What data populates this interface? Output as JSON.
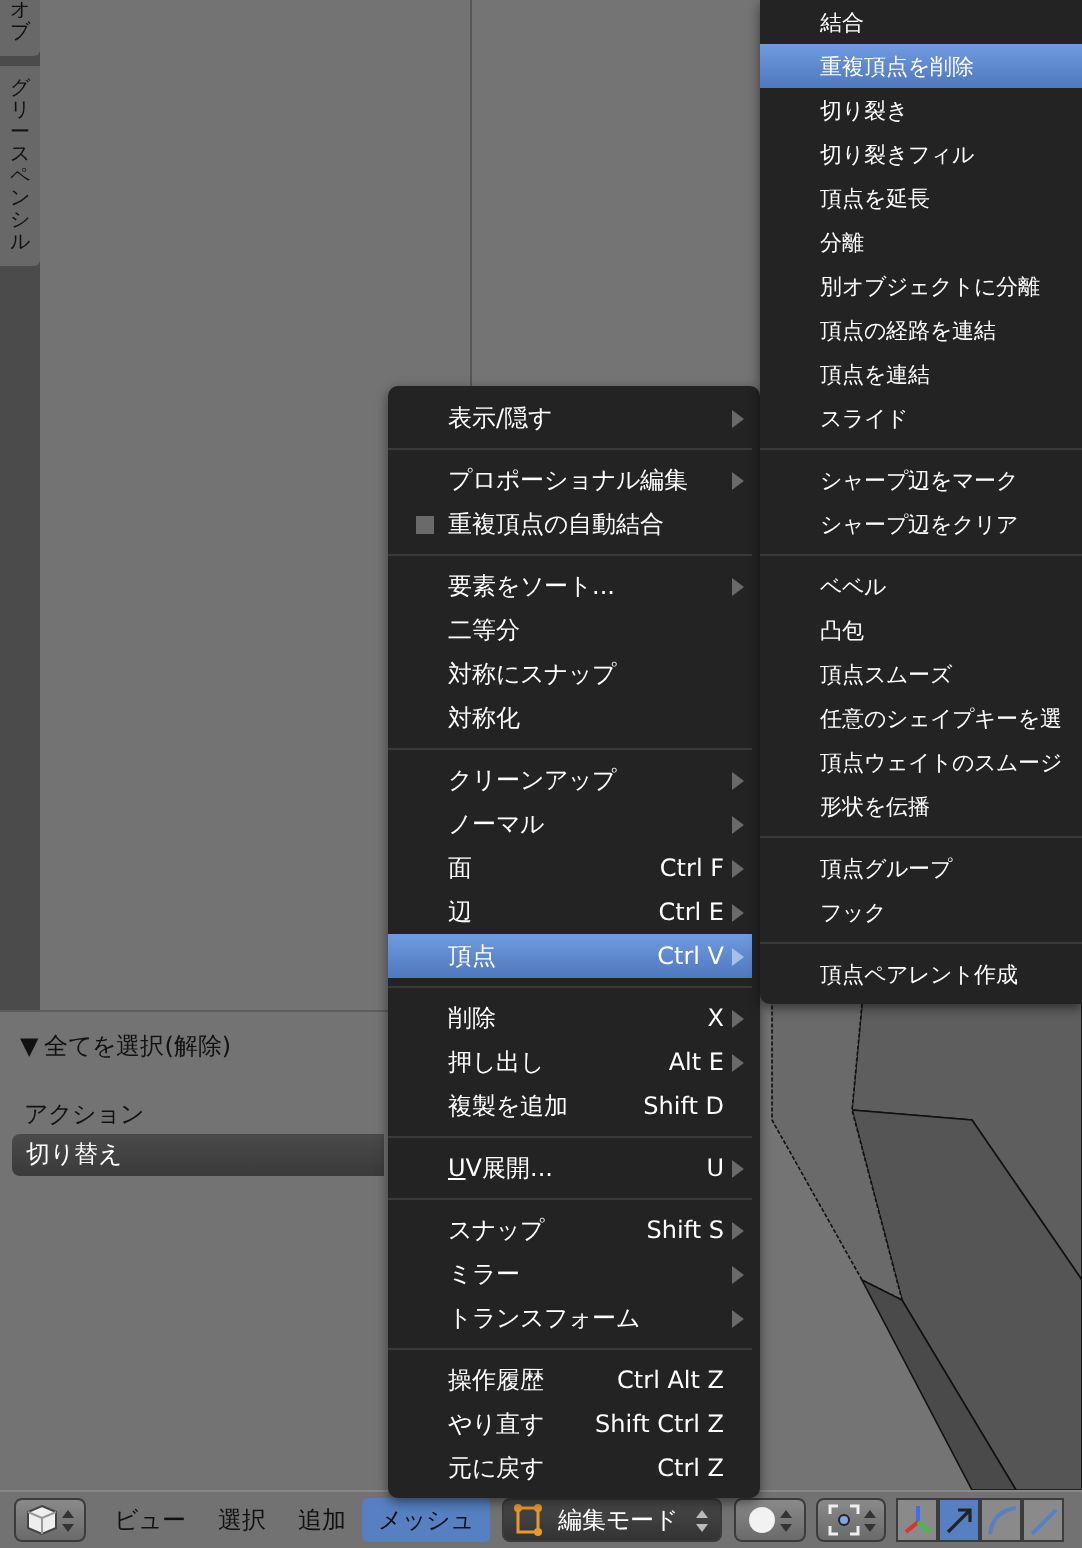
{
  "tool_shelf": {
    "tabs": [
      {
        "label": "オブ",
        "selected": false
      },
      {
        "label": "グリースペンシル",
        "selected": false
      }
    ]
  },
  "operator_panel": {
    "toggle_icon": "▼",
    "title": "全てを選択(解除)",
    "action_label": "アクション",
    "action_value": "切り替え"
  },
  "menu": {
    "groups": [
      [
        {
          "label": "表示/隠す",
          "submenu": true,
          "selected": false
        }
      ],
      [
        {
          "label": "プロポーショナル編集",
          "submenu": true,
          "selected": false
        },
        {
          "label": "重複頂点の自動結合",
          "kind": "checkbox",
          "checked": false,
          "submenu": false,
          "selected": false
        }
      ],
      [
        {
          "label": "要素をソート...",
          "submenu": true,
          "selected": false
        },
        {
          "label": "二等分",
          "submenu": false,
          "selected": false
        },
        {
          "label": "対称にスナップ",
          "submenu": false,
          "selected": false
        },
        {
          "label": "対称化",
          "submenu": false,
          "selected": false
        }
      ],
      [
        {
          "label": "クリーンアップ",
          "submenu": true,
          "selected": false
        },
        {
          "label": "ノーマル",
          "submenu": true,
          "selected": false
        },
        {
          "label": "面",
          "shortcut": "Ctrl F",
          "submenu": true,
          "selected": false
        },
        {
          "label": "辺",
          "shortcut": "Ctrl E",
          "submenu": true,
          "selected": false
        },
        {
          "label": "頂点",
          "shortcut": "Ctrl V",
          "submenu": true,
          "selected": true
        }
      ],
      [
        {
          "label": "削除",
          "shortcut": "X",
          "submenu": true,
          "selected": false
        },
        {
          "label": "押し出し",
          "shortcut": "Alt E",
          "submenu": true,
          "selected": false
        },
        {
          "label": "複製を追加",
          "shortcut": "Shift D",
          "submenu": false,
          "selected": false
        }
      ],
      [
        {
          "label": "UV展開...",
          "shortcut": "U",
          "submenu": true,
          "underline_first": true,
          "selected": false
        }
      ],
      [
        {
          "label": "スナップ",
          "shortcut": "Shift S",
          "submenu": true,
          "selected": false
        },
        {
          "label": "ミラー",
          "submenu": true,
          "selected": false
        },
        {
          "label": "トランスフォーム",
          "submenu": true,
          "selected": false
        }
      ],
      [
        {
          "label": "操作履歴",
          "shortcut": "Ctrl Alt Z",
          "submenu": false,
          "selected": false
        },
        {
          "label": "やり直す",
          "shortcut": "Shift Ctrl Z",
          "submenu": false,
          "selected": false
        },
        {
          "label": "元に戻す",
          "shortcut": "Ctrl Z",
          "submenu": false,
          "selected": false
        }
      ]
    ]
  },
  "submenu": {
    "groups": [
      [
        {
          "label": "結合",
          "selected": false
        },
        {
          "label": "重複頂点を削除",
          "selected": true
        },
        {
          "label": "切り裂き",
          "selected": false
        },
        {
          "label": "切り裂きフィル",
          "selected": false
        },
        {
          "label": "頂点を延長",
          "selected": false
        },
        {
          "label": "分離",
          "selected": false
        },
        {
          "label": "別オブジェクトに分離",
          "selected": false
        },
        {
          "label": "頂点の経路を連結",
          "selected": false
        },
        {
          "label": "頂点を連結",
          "selected": false
        },
        {
          "label": "スライド",
          "selected": false
        }
      ],
      [
        {
          "label": "シャープ辺をマーク",
          "selected": false
        },
        {
          "label": "シャープ辺をクリア",
          "selected": false
        }
      ],
      [
        {
          "label": "ベベル",
          "selected": false
        },
        {
          "label": "凸包",
          "selected": false
        },
        {
          "label": "頂点スムーズ",
          "selected": false
        },
        {
          "label": "任意のシェイプキーを選",
          "selected": false
        },
        {
          "label": "頂点ウェイトのスムージ",
          "selected": false
        },
        {
          "label": "形状を伝播",
          "selected": false
        }
      ],
      [
        {
          "label": "頂点グループ",
          "selected": false
        },
        {
          "label": "フック",
          "selected": false
        }
      ],
      [
        {
          "label": "頂点ペアレント作成",
          "selected": false
        }
      ]
    ]
  },
  "header": {
    "menus": [
      {
        "label": "ビュー",
        "selected": false
      },
      {
        "label": "選択",
        "selected": false
      },
      {
        "label": "追加",
        "selected": false
      },
      {
        "label": "メッシュ",
        "selected": true
      }
    ],
    "mode": "編集モード",
    "manipulators": [
      {
        "kind": "translate",
        "selected": true
      },
      {
        "kind": "rotate",
        "selected": false
      },
      {
        "kind": "scale",
        "selected": false
      }
    ]
  }
}
